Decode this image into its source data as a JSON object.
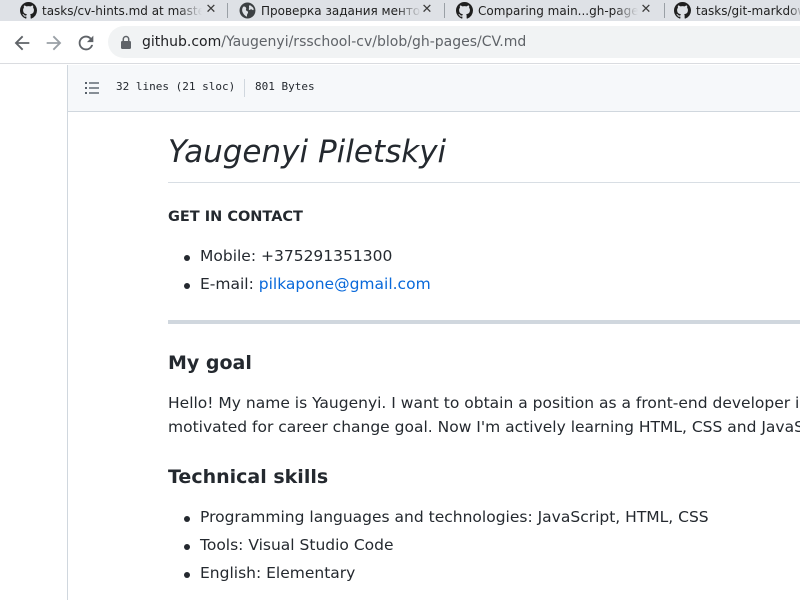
{
  "tabs": [
    {
      "title": "tasks/cv-hints.md at master · ",
      "icon": "github-icon"
    },
    {
      "title": "Проверка задания менторо",
      "icon": "globe-icon"
    },
    {
      "title": "Comparing main...gh-pages · ",
      "icon": "github-icon"
    },
    {
      "title": "tasks/git-markdown",
      "icon": "github-icon"
    }
  ],
  "toolbar": {
    "url_host": "github.com",
    "url_path": "/Yaugenyi/rsschool-cv/blob/gh-pages/CV.md"
  },
  "file_header": {
    "lines": "32 lines (21 sloc)",
    "size": "801 Bytes"
  },
  "document": {
    "title": "Yaugenyi Piletskyi",
    "contact_heading": "GET IN CONTACT",
    "mobile": "Mobile: +375291351300",
    "email_label": "E-mail: ",
    "email": "pilkapone@gmail.com",
    "goal_heading": "My goal",
    "goal_line1": "Hello! My name is Yaugenyi. I want to obtain a position as a front-end developer in your c",
    "goal_line2": "motivated for career change goal. Now I'm actively learning HTML, CSS and JavaScript. I li",
    "skills_heading": "Technical skills",
    "skills": [
      "Programming languages and technologies: JavaScript, HTML, CSS",
      "Tools: Visual Studio Code",
      "English: Elementary"
    ]
  },
  "colors": {
    "link": "#0969da",
    "tabstrip": "#dee1e6",
    "omnibox": "#f1f3f4"
  }
}
